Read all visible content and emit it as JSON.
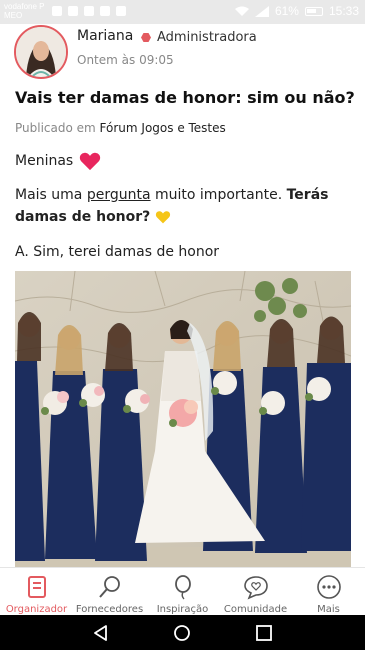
{
  "status_bar": {
    "carrier_line1": "vodafone P",
    "carrier_line2": "MEO",
    "battery": "61%",
    "time": "15:33"
  },
  "post": {
    "author": "Mariana",
    "role": "Administradora",
    "timestamp": "Ontem às 09:05",
    "title": "Vais ter damas de honor: sim ou não?",
    "published_prefix": "Publicado em",
    "forum": "Fórum Jogos e Testes",
    "paragraph1": "Meninas",
    "paragraph2_a": "Mais uma ",
    "paragraph2_link": "pergunta",
    "paragraph2_b": " muito importante. ",
    "paragraph2_bold": "Terás damas de honor?",
    "paragraph3": "A. Sim, terei damas de honor"
  },
  "bottom_nav": {
    "items": [
      {
        "label": "Organizador",
        "icon": "organizer-icon",
        "active": true
      },
      {
        "label": "Fornecedores",
        "icon": "search-icon",
        "active": false
      },
      {
        "label": "Inspiração",
        "icon": "balloon-icon",
        "active": false
      },
      {
        "label": "Comunidade",
        "icon": "chat-heart-icon",
        "active": false
      },
      {
        "label": "Mais",
        "icon": "more-icon",
        "active": false
      }
    ]
  },
  "colors": {
    "accent": "#e35a5f",
    "heart": "#e8265e",
    "yellow_heart": "#f5c518",
    "dress_navy": "#1c2d5e"
  }
}
